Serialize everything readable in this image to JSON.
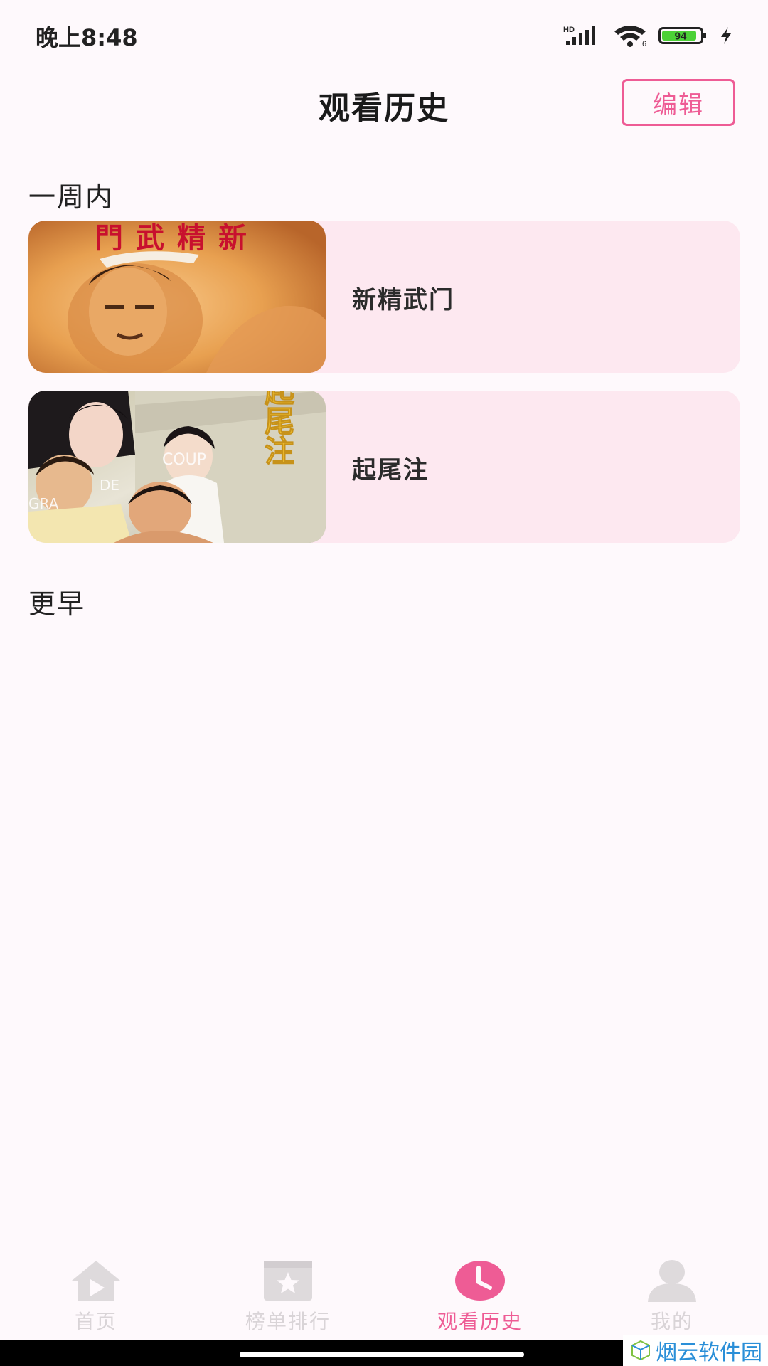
{
  "status_bar": {
    "time": "晚上8:48",
    "network_label": "HD",
    "wifi_sub": "6",
    "battery": "94"
  },
  "header": {
    "title": "观看历史",
    "edit_label": "编辑"
  },
  "sections": {
    "week_title": "一周内",
    "earlier_title": "更早"
  },
  "history": [
    {
      "title": "新精武门",
      "poster_text": "門武精新"
    },
    {
      "title": "起尾注",
      "poster_text": "起尾注"
    }
  ],
  "bottom_nav": [
    {
      "label": "首页",
      "icon": "home-icon",
      "active": false
    },
    {
      "label": "榜单排行",
      "icon": "ranking-star-icon",
      "active": false
    },
    {
      "label": "观看历史",
      "icon": "clock-icon",
      "active": true
    },
    {
      "label": "我的",
      "icon": "user-icon",
      "active": false
    }
  ],
  "watermark": "烟云软件园",
  "colors": {
    "accent": "#EE5C95",
    "card_bg": "#FDE8F0",
    "page_bg": "#FEF9FC",
    "nav_inactive": "#D9D4D7"
  }
}
